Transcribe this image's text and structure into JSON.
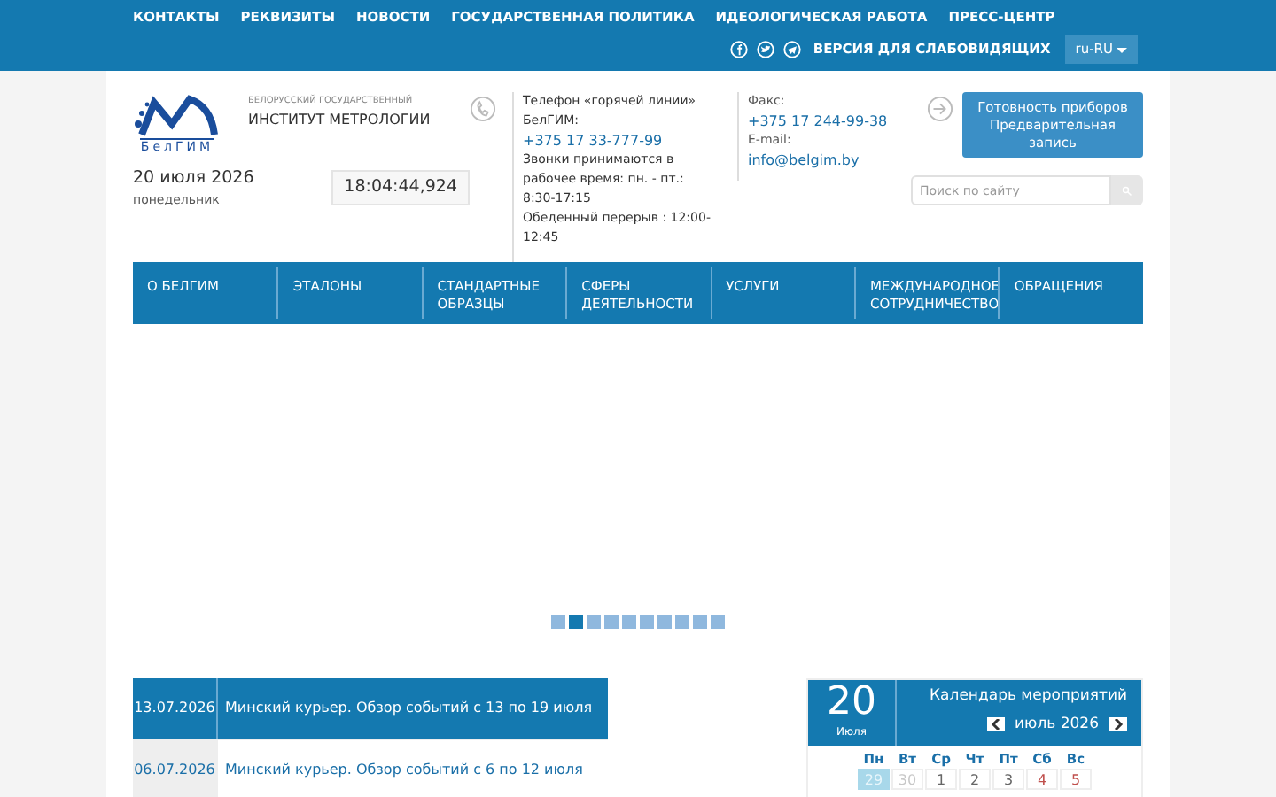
{
  "top_links": [
    "КОНТАКТЫ",
    "РЕКВИЗИТЫ",
    "НОВОСТИ",
    "ГОСУДАРСТВЕННАЯ ПОЛИТИКА",
    "ИДЕОЛОГИЧЕСКАЯ РАБОТА",
    "ПРЕСС-ЦЕНТР"
  ],
  "accessibility_link": "ВЕРСИЯ ДЛЯ СЛАБОВИДЯЩИХ",
  "language": "ru-RU",
  "logo": {
    "caption": "БелГИМ",
    "subtitle": "БЕЛОРУССКИЙ ГОСУДАРСТВЕННЫЙ",
    "title": "ИНСТИТУТ МЕТРОЛОГИИ"
  },
  "date": "20 июля 2026",
  "weekday": "понедельник",
  "clock": "18:04:44,924",
  "hotline": {
    "label": "Телефон «горячей линии» БелГИМ:",
    "phone": "+375 17 33-777-99",
    "hours": "Звонки принимаются в рабочее время: пн. - пт.: 8:30-17:15",
    "lunch": "Обеденный перерыв : 12:00-12:45"
  },
  "fax": {
    "label": "Факс:",
    "phone": "+375 17 244-99-38",
    "email_label": "E-mail:",
    "email": "info@belgim.by"
  },
  "readiness_button": "Готовность приборов Предварительная запись",
  "search": {
    "placeholder": "Поиск по сайту"
  },
  "nav": [
    "О БЕЛГИМ",
    "ЭТАЛОНЫ",
    "СТАНДАРТНЫЕ ОБРАЗЦЫ",
    "СФЕРЫ ДЕЯТЕЛЬНОСТИ",
    "УСЛУГИ",
    "МЕЖДУНАРОДНОЕ СОТРУДНИЧЕСТВО",
    "ОБРАЩЕНИЯ"
  ],
  "slider_dots": [
    {
      "selected": false
    },
    {
      "selected": true
    },
    {
      "selected": false
    },
    {
      "selected": false
    },
    {
      "selected": false
    },
    {
      "selected": false
    },
    {
      "selected": false
    },
    {
      "selected": false
    },
    {
      "selected": false
    },
    {
      "selected": false
    }
  ],
  "news": [
    {
      "date": "13.07.2026",
      "title": "Минский курьер. Обзор событий с 13 по 19 июля",
      "selected": true
    },
    {
      "date": "06.07.2026",
      "title": "Минский курьер. Обзор событий с 6 по 12 июля",
      "selected": false
    }
  ],
  "calendar": {
    "day": "20",
    "month": "Июля",
    "title": "Календарь мероприятий",
    "period": "июль 2026",
    "weekdays": [
      "Пн",
      "Вт",
      "Ср",
      "Чт",
      "Пт",
      "Сб",
      "Вс"
    ],
    "days": [
      {
        "label": "29",
        "kind": "other",
        "selected": true
      },
      {
        "label": "30",
        "kind": "other",
        "selected": false
      },
      {
        "label": "1",
        "kind": "weekday",
        "selected": false
      },
      {
        "label": "2",
        "kind": "weekday",
        "selected": false
      },
      {
        "label": "3",
        "kind": "weekday",
        "selected": false
      },
      {
        "label": "4",
        "kind": "weekend",
        "selected": false
      },
      {
        "label": "5",
        "kind": "weekend",
        "selected": false
      }
    ]
  }
}
